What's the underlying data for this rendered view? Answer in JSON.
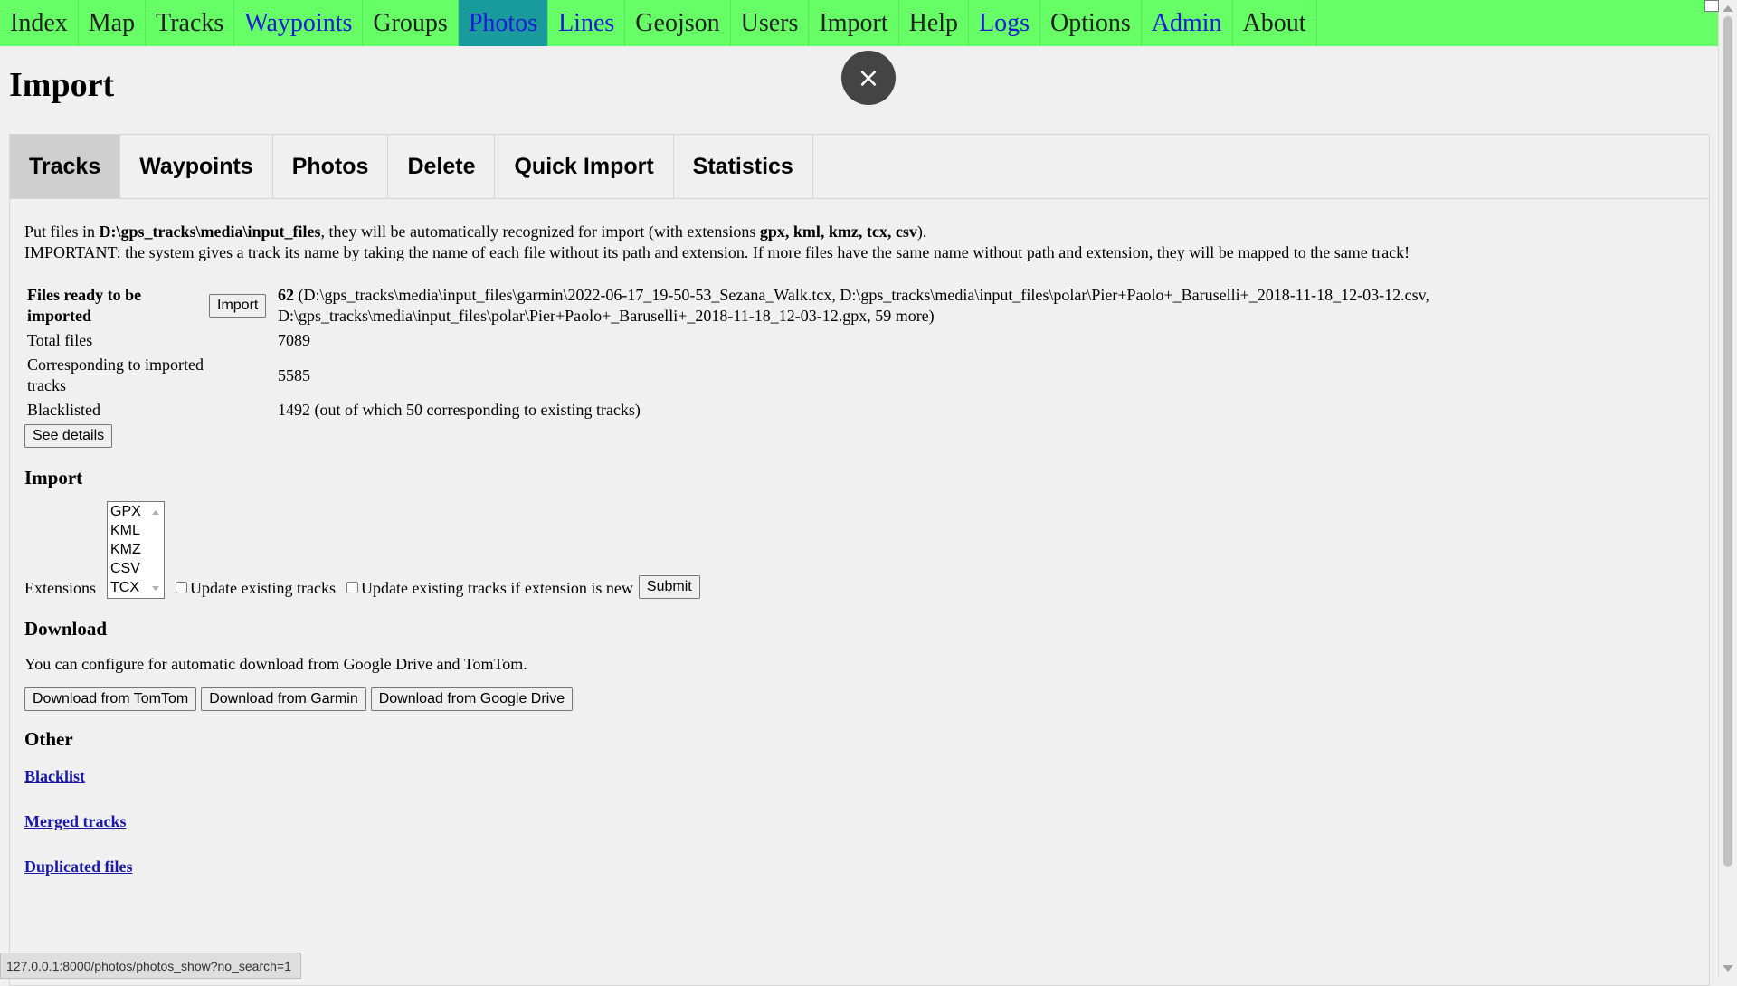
{
  "nav": {
    "items": [
      {
        "label": "Index",
        "style": "plain"
      },
      {
        "label": "Map",
        "style": "plain"
      },
      {
        "label": "Tracks",
        "style": "plain"
      },
      {
        "label": "Waypoints",
        "style": "link"
      },
      {
        "label": "Groups",
        "style": "plain"
      },
      {
        "label": "Photos",
        "style": "active"
      },
      {
        "label": "Lines",
        "style": "link"
      },
      {
        "label": "Geojson",
        "style": "plain"
      },
      {
        "label": "Users",
        "style": "plain"
      },
      {
        "label": "Import",
        "style": "plain"
      },
      {
        "label": "Help",
        "style": "plain"
      },
      {
        "label": "Logs",
        "style": "link"
      },
      {
        "label": "Options",
        "style": "plain"
      },
      {
        "label": "Admin",
        "style": "link"
      },
      {
        "label": "About",
        "style": "plain"
      }
    ]
  },
  "page": {
    "title": "Import",
    "close_icon": "×"
  },
  "tabs": [
    {
      "label": "Tracks",
      "active": true
    },
    {
      "label": "Waypoints",
      "active": false
    },
    {
      "label": "Photos",
      "active": false
    },
    {
      "label": "Delete",
      "active": false
    },
    {
      "label": "Quick Import",
      "active": false
    },
    {
      "label": "Statistics",
      "active": false
    }
  ],
  "intro": {
    "line1_pre": "Put files in ",
    "line1_path": "D:\\gps_tracks\\media\\input_files",
    "line1_mid": ", they will be automatically recognized for import (with extensions ",
    "line1_exts": "gpx, kml, kmz, tcx, csv",
    "line1_post": ").",
    "line2": "IMPORTANT: the system gives a track its name by taking the name of each file without its path and extension. If more files have the same name without path and extension, they will be mapped to the same track!"
  },
  "stats": {
    "ready_label": "Files ready to be imported",
    "import_button": "Import",
    "ready_count": "62",
    "ready_detail": " (D:\\gps_tracks\\media\\input_files\\garmin\\2022-06-17_19-50-53_Sezana_Walk.tcx, D:\\gps_tracks\\media\\input_files\\polar\\Pier+Paolo+_Baruselli+_2018-11-18_12-03-12.csv, D:\\gps_tracks\\media\\input_files\\polar\\Pier+Paolo+_Baruselli+_2018-11-18_12-03-12.gpx, 59 more)",
    "total_label": "Total files",
    "total_value": "7089",
    "corresponding_label": "Corresponding to imported tracks",
    "corresponding_value": "5585",
    "blacklisted_label": "Blacklisted",
    "blacklisted_value": "1492 (out of which 50 corresponding to existing tracks)",
    "details_button": "See details"
  },
  "import_section": {
    "heading": "Import",
    "extensions_label": "Extensions",
    "extensions": [
      "GPX",
      "KML",
      "KMZ",
      "CSV",
      "TCX"
    ],
    "update_label": "Update existing tracks",
    "update_new_ext_label": "Update existing tracks if extension is new",
    "submit_button": "Submit"
  },
  "download_section": {
    "heading": "Download",
    "text": "You can configure for automatic download from Google Drive and TomTom.",
    "tomtom_button": "Download from TomTom",
    "garmin_button": "Download from Garmin",
    "gdrive_button": "Download from Google Drive"
  },
  "other_section": {
    "heading": "Other",
    "blacklist_link": "Blacklist",
    "merged_link": "Merged tracks",
    "duplicated_link": "Duplicated files"
  },
  "status_url": "127.0.0.1:8000/photos/photos_show?no_search=1"
}
